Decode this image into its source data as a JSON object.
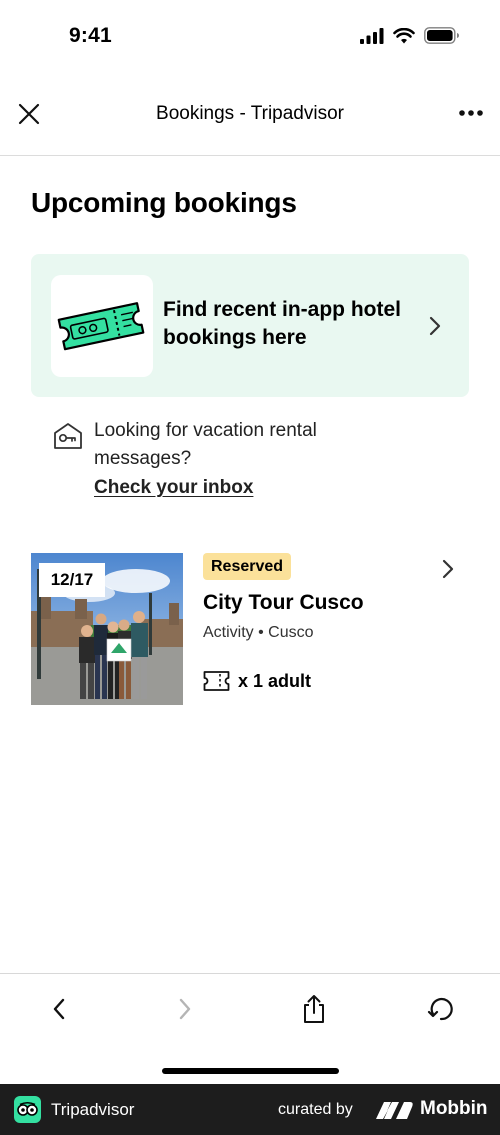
{
  "status_bar": {
    "time": "9:41"
  },
  "header": {
    "title": "Bookings - Tripadvisor"
  },
  "main": {
    "page_title": "Upcoming bookings",
    "promo": {
      "text": "Find recent in-app hotel bookings here"
    },
    "rental_notice": {
      "text": "Looking for vacation rental messages?",
      "link": "Check your inbox"
    },
    "bookings": [
      {
        "date": "12/17",
        "status": "Reserved",
        "title": "City Tour Cusco",
        "meta": "Activity • Cusco",
        "guests": "x 1 adult"
      }
    ]
  },
  "footer": {
    "app_name": "Tripadvisor",
    "curated_by": "curated by",
    "brand": "Mobbin"
  },
  "colors": {
    "promo_background": "#e9f8f1",
    "ticket_green": "#34e0a1",
    "status_pill": "#fbe19a",
    "footer_background": "#1d1d1d"
  },
  "icons": [
    "close-icon",
    "more-icon",
    "ticket-illustration",
    "chevron-right-icon",
    "key-house-icon",
    "ticket-icon",
    "back-icon",
    "forward-icon",
    "share-icon",
    "refresh-icon"
  ]
}
